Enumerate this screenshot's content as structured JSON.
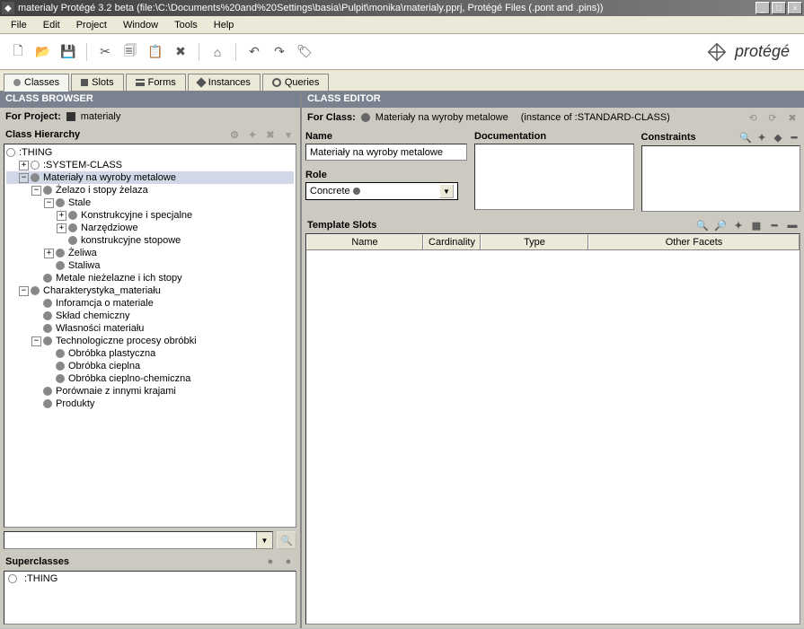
{
  "titlebar": {
    "text": "materialy  Protégé 3.2 beta    (file:\\C:\\Documents%20and%20Settings\\basia\\Pulpit\\monika\\materialy.pprj, Protégé Files (.pont and .pins))"
  },
  "menu": {
    "items": [
      "File",
      "Edit",
      "Project",
      "Window",
      "Tools",
      "Help"
    ]
  },
  "logo": {
    "text": "protégé"
  },
  "tabs": {
    "items": [
      {
        "label": "Classes"
      },
      {
        "label": "Slots"
      },
      {
        "label": "Forms"
      },
      {
        "label": "Instances"
      },
      {
        "label": "Queries"
      }
    ]
  },
  "classBrowser": {
    "title": "CLASS BROWSER",
    "forProjectLabel": "For Project:",
    "projectName": "materialy",
    "hierarchyLabel": "Class Hierarchy",
    "superclassesLabel": "Superclasses",
    "superclassItem": ":THING",
    "tree": {
      "root": ":THING",
      "systemClass": ":SYSTEM-CLASS",
      "selected": "Materiały na wyroby metalowe",
      "n1": "Żelazo i stopy żelaza",
      "n1_1": "Stale",
      "n1_1_1": "Konstrukcyjne i specjalne",
      "n1_1_2": "Narzędziowe",
      "n1_1_3": "konstrukcyjne stopowe",
      "n1_2": "Żeliwa",
      "n1_3": "Staliwa",
      "n2": "Metale nieżelazne i ich stopy",
      "c": "Charakterystyka_materiału",
      "c1": "Inforamcja o materiale",
      "c2": "Skład chemiczny",
      "c3": "Własności materiału",
      "c4": "Technologiczne procesy obróbki",
      "c4_1": "Obróbka plastyczna",
      "c4_2": "Obróbka cieplna",
      "c4_3": "Obróbka cieplno-chemiczna",
      "c5": "Porównaie z innymi krajami",
      "c6": "Produkty"
    }
  },
  "classEditor": {
    "title": "CLASS EDITOR",
    "forClassLabel": "For Class:",
    "className": "Materiały na wyroby metalowe",
    "instanceOf": "(instance of :STANDARD-CLASS)",
    "nameLabel": "Name",
    "nameValue": "Materiały na wyroby metalowe",
    "roleLabel": "Role",
    "roleValue": "Concrete",
    "docLabel": "Documentation",
    "constraintsLabel": "Constraints",
    "templateSlotsLabel": "Template Slots",
    "cols": {
      "name": "Name",
      "cardinality": "Cardinality",
      "type": "Type",
      "otherFacets": "Other Facets"
    }
  }
}
